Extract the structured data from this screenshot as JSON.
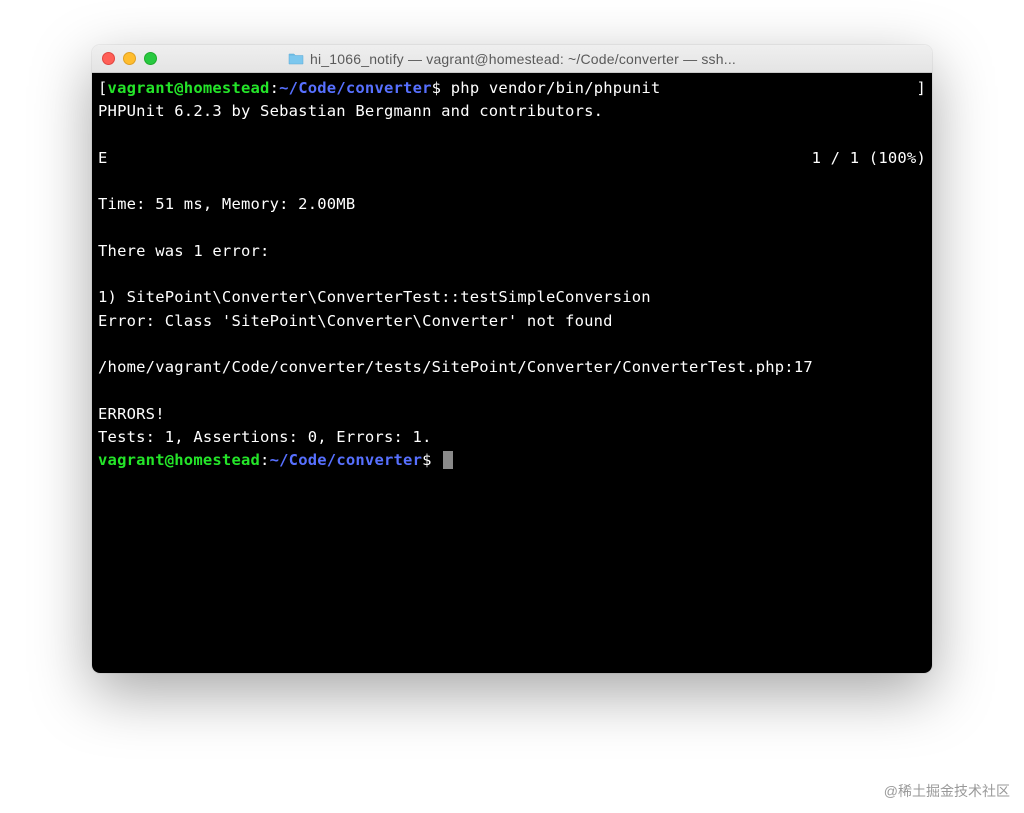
{
  "window": {
    "title": "hi_1066_notify — vagrant@homestead: ~/Code/converter — ssh..."
  },
  "prompt": {
    "user_host": "vagrant@homestead",
    "colon": ":",
    "path": "~/Code/converter",
    "dollar": "$"
  },
  "command": "php vendor/bin/phpunit",
  "output": {
    "header": "PHPUnit 6.2.3 by Sebastian Bergmann and contributors.",
    "progress_char": "E",
    "progress_count": "1 / 1 (100%)",
    "time_mem": "Time: 51 ms, Memory: 2.00MB",
    "error_intro": "There was 1 error:",
    "error_test": "1) SitePoint\\Converter\\ConverterTest::testSimpleConversion",
    "error_msg": "Error: Class 'SitePoint\\Converter\\Converter' not found",
    "error_path": "/home/vagrant/Code/converter/tests/SitePoint/Converter/ConverterTest.php:17",
    "errors_label": "ERRORS!",
    "summary": "Tests: 1, Assertions: 0, Errors: 1."
  },
  "watermark": "@稀土掘金技术社区"
}
